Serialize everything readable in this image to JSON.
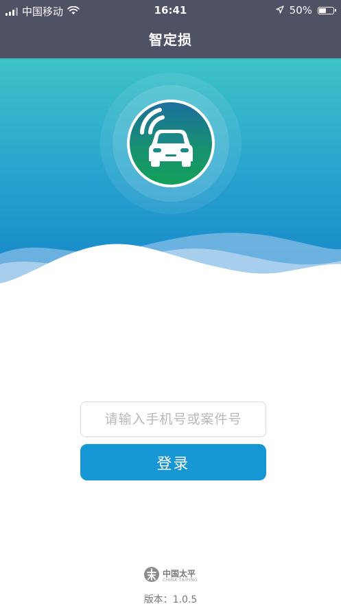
{
  "status_bar": {
    "carrier": "中国移动",
    "time": "16:41",
    "battery_percent": "50%",
    "icons": [
      "signal-icon",
      "wifi-icon",
      "location-arrow-icon",
      "battery-icon"
    ]
  },
  "nav": {
    "title": "智定损"
  },
  "hero": {
    "logo_icon": "car-signal-icon",
    "colors": {
      "gradient_top": "#3ec3c6",
      "gradient_bottom": "#1485c9"
    }
  },
  "login": {
    "phone_placeholder": "请输入手机号或案件号",
    "phone_value": "",
    "submit_label": "登录",
    "accent_color": "#1696d3"
  },
  "footer": {
    "brand_icon": "china-taiping-logo-icon",
    "brand_name_cn": "中国太平",
    "brand_name_en": "CHINA TAIPING",
    "version_label": "版本：",
    "version_number": "1.0.5"
  }
}
